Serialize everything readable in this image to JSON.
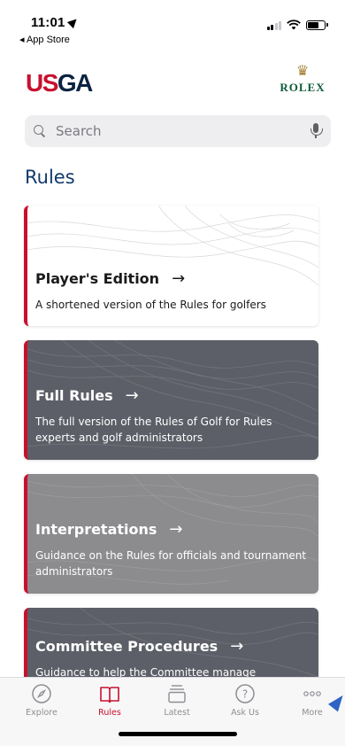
{
  "status_bar": {
    "time": "11:01",
    "back_app": "◂ App Store"
  },
  "header": {
    "logo_left_part1": "US",
    "logo_left_part2": "GA",
    "logo_right": "ROLEX"
  },
  "search": {
    "placeholder": "Search"
  },
  "section": {
    "title": "Rules"
  },
  "cards": [
    {
      "title": "Player's Edition",
      "arrow": "→",
      "description": "A shortened version of the Rules for golfers"
    },
    {
      "title": "Full Rules",
      "arrow": "→",
      "description": "The full version of the Rules of Golf for Rules experts and golf administrators"
    },
    {
      "title": "Interpretations",
      "arrow": "→",
      "description": "Guidance on the Rules for officials and tournament administrators"
    },
    {
      "title": "Committee Procedures",
      "arrow": "→",
      "description": "Guidance to help the Committee manage"
    }
  ],
  "tabbar": {
    "items": [
      {
        "label": "Explore",
        "icon": "compass-icon",
        "active": false
      },
      {
        "label": "Rules",
        "icon": "book-icon",
        "active": true
      },
      {
        "label": "Latest",
        "icon": "stack-icon",
        "active": false
      },
      {
        "label": "Ask Us",
        "icon": "question-icon",
        "active": false
      },
      {
        "label": "More",
        "icon": "more-icon",
        "active": false
      }
    ]
  },
  "colors": {
    "brand_red": "#c8102e",
    "brand_navy": "#0b2341",
    "section_title": "#123a6b",
    "card_dark": "#5d5f68",
    "card_mid": "#8c8c8f"
  }
}
